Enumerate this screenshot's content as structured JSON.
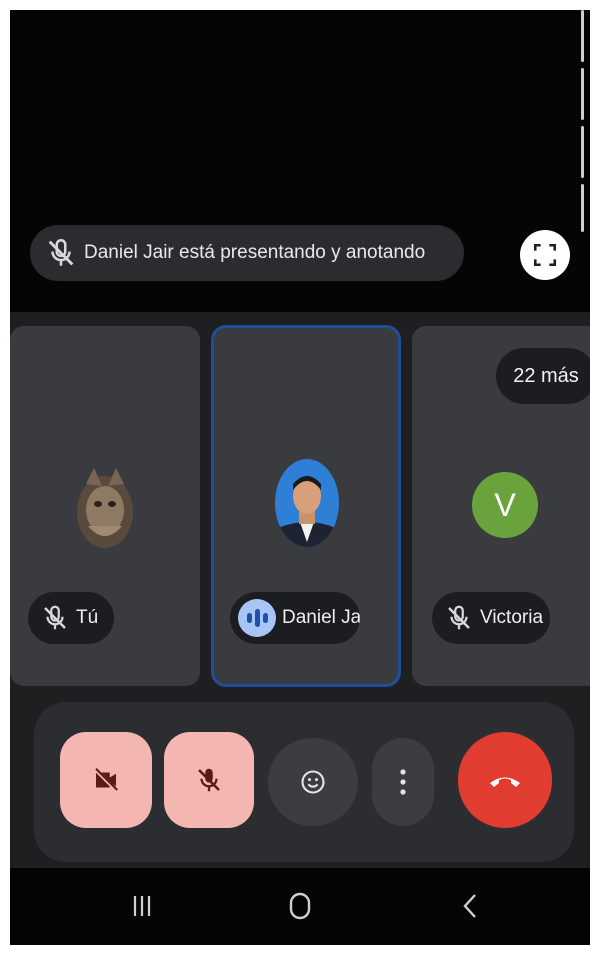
{
  "presentation": {
    "banner_text": "Daniel Jair está presentando y anotando"
  },
  "tiles": [
    {
      "name": "Tú",
      "mic": "muted"
    },
    {
      "name": "Daniel Ja",
      "mic": "speaking"
    },
    {
      "name": "Victoria",
      "mic": "muted",
      "avatar_letter": "V"
    }
  ],
  "more_participants": "22 más",
  "colors": {
    "avatar_victoria": "#6aa33c",
    "hangup": "#e03c2f",
    "muted_controls": "#f3b6b1",
    "active_tile_border": "#1d4f9c"
  },
  "controls": {
    "camera": "camera-off-icon",
    "microphone": "mic-off-icon",
    "reactions": "emoji-icon",
    "more": "more-vert-icon",
    "leave": "call-end-icon"
  },
  "nav_icons": [
    "recent-apps-icon",
    "home-icon",
    "back-icon"
  ]
}
